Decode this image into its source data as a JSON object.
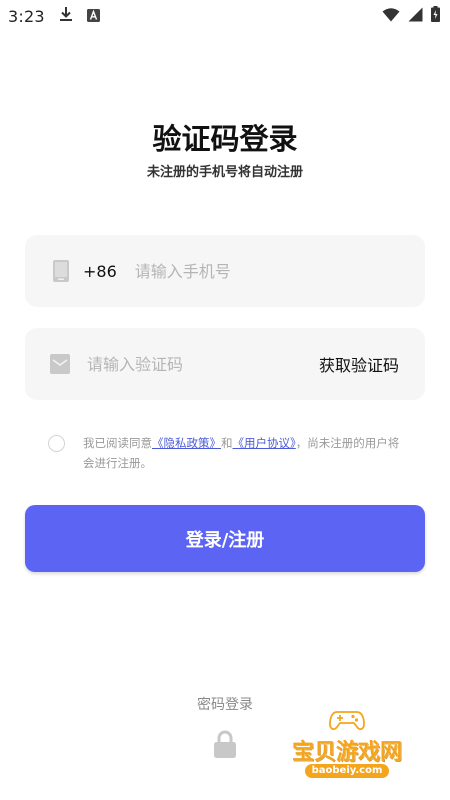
{
  "status_bar": {
    "time": "3:23",
    "icons": [
      "download-icon",
      "a-letter-icon",
      "wifi-icon",
      "signal-icon",
      "battery-charging-icon"
    ]
  },
  "header": {
    "title": "验证码登录",
    "subtitle": "未注册的手机号将自动注册"
  },
  "phone_field": {
    "country_code": "+86",
    "placeholder": "请输入手机号",
    "value": ""
  },
  "code_field": {
    "placeholder": "请输入验证码",
    "value": "",
    "get_code_label": "获取验证码"
  },
  "agreement": {
    "prefix": "我已阅读同意",
    "privacy_link": "《隐私政策》",
    "and": "和",
    "user_link": "《用户协议》",
    "suffix": "，尚未注册的用户将会进行注册。",
    "checked": false
  },
  "login_button": {
    "label": "登录/注册"
  },
  "footer": {
    "password_login_label": "密码登录"
  },
  "watermark": {
    "title": "宝贝游戏网",
    "url": "baobeiy.com"
  },
  "colors": {
    "primary": "#5c64f4",
    "link": "#4a5bd8",
    "field_bg": "#f6f6f6",
    "watermark": "#f5a51c"
  }
}
